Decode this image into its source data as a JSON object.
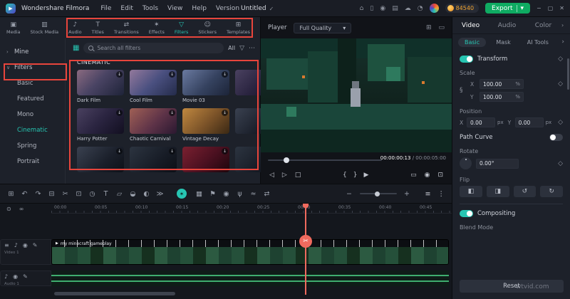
{
  "titlebar": {
    "app": "Wondershare Filmora",
    "menus": [
      "File",
      "Edit",
      "Tools",
      "View",
      "Help",
      "Version"
    ],
    "project": "Untitled",
    "credits": "84540",
    "export": "Export"
  },
  "ribbon": {
    "tabs": [
      {
        "label": "Media"
      },
      {
        "label": "Stock Media"
      },
      {
        "label": "Audio"
      },
      {
        "label": "Titles"
      },
      {
        "label": "Transitions"
      },
      {
        "label": "Effects"
      },
      {
        "label": "Filters"
      },
      {
        "label": "Stickers"
      },
      {
        "label": "Templates"
      }
    ],
    "active": "Filters"
  },
  "sidebar": {
    "mine": "Mine",
    "filters": "Filters",
    "categories": [
      "Basic",
      "Featured",
      "Mono",
      "Cinematic",
      "Spring",
      "Portrait"
    ],
    "active": "Cinematic"
  },
  "filters": {
    "search_placeholder": "Search all filters",
    "all": "All",
    "section": "CINEMATIC",
    "names": [
      "Dark Film",
      "Cool Film",
      "Movie 03",
      "Harry Potter",
      "Chaotic Carnival",
      "Vintage Decay"
    ]
  },
  "player": {
    "label": "Player",
    "quality": "Full Quality",
    "time_current": "00:00:00:13",
    "time_total": "/ 00:00:05:00"
  },
  "inspector": {
    "tabs": [
      "Video",
      "Audio",
      "Color"
    ],
    "active_tab": "Video",
    "subtabs": [
      "Basic",
      "Mask",
      "AI Tools"
    ],
    "active_subtab": "Basic",
    "transform": "Transform",
    "scale": "Scale",
    "x": "X",
    "y": "Y",
    "scale_x": "100.00",
    "scale_y": "100.00",
    "pct": "%",
    "position": "Position",
    "pos_x": "0.00",
    "pos_y": "0.00",
    "px": "px",
    "path_curve": "Path Curve",
    "rotate": "Rotate",
    "rotate_value": "0.00°",
    "flip": "Flip",
    "compositing": "Compositing",
    "blend_mode": "Blend Mode",
    "reset": "Reset"
  },
  "timeline": {
    "ruler": [
      "00:00",
      "00:05",
      "00:10",
      "00:15",
      "00:20",
      "00:25",
      "00:30",
      "00:35",
      "00:40",
      "00:45"
    ],
    "clip": "my minecraft gameplay",
    "video_track": "Video 1",
    "audio_track": "Audio 1"
  },
  "watermark": "wtvid.com",
  "colors": {
    "accent_teal": "#27c5b2",
    "export_green": "#0fab62",
    "annotation_red": "#e8453c",
    "playhead_red": "#ef6a5e",
    "coin_orange": "#f0a32f"
  },
  "icons": {
    "logo": "▶",
    "check": "✓",
    "store": "⌂",
    "mobile": "▯",
    "record_screen": "◉",
    "layout": "▤",
    "cloud": "☁",
    "bell": "◔",
    "minimize": "−",
    "maximize": "▢",
    "close": "✕",
    "caret": "▾",
    "chev_r": "›",
    "chev_d": "∨",
    "media": "▣",
    "stock": "▥",
    "audio": "♪",
    "titles": "T",
    "transitions": "⇄",
    "effects": "✶",
    "filters": "▽",
    "stickers": "☺",
    "templates": "⊞",
    "collection": "▦",
    "funnel": "▽",
    "dots": "⋯",
    "download": "↓",
    "grid_view": "⊞",
    "monitor": "▭",
    "prev_frame": "◁",
    "play": "▷",
    "stop": "□",
    "mark_in": "{",
    "mark_out": "}",
    "camera": "◉",
    "fullscreen": "⊡",
    "diamond": "◇",
    "chain": "§",
    "flip_h": "◧",
    "flip_v": "◨",
    "rot_ccw": "↺",
    "rot_cw": "↻",
    "t_layout": "⊞",
    "t_undo": "↶",
    "t_redo": "↷",
    "t_trash": "⊟",
    "t_split": "✂",
    "t_crop": "⊡",
    "t_speed": "◷",
    "t_text": "T",
    "t_transform": "▱",
    "t_chroma": "◒",
    "t_mask": "◐",
    "t_more": "≫",
    "t_ai": "✶",
    "t_clip": "▦",
    "t_marker": "⚑",
    "t_record": "◉",
    "t_mic": "ψ",
    "t_voice": "≈",
    "t_pip": "⇄",
    "zoom_out": "−",
    "zoom_in": "+",
    "t_list": "≡",
    "t_adjust": "⋮",
    "snap": "⊙",
    "link": "∞",
    "tr_menu": "≡",
    "tr_mute": "♪",
    "tr_eye": "◉",
    "tr_pen": "✎",
    "clip_play": "▶",
    "scissors": "✂"
  }
}
